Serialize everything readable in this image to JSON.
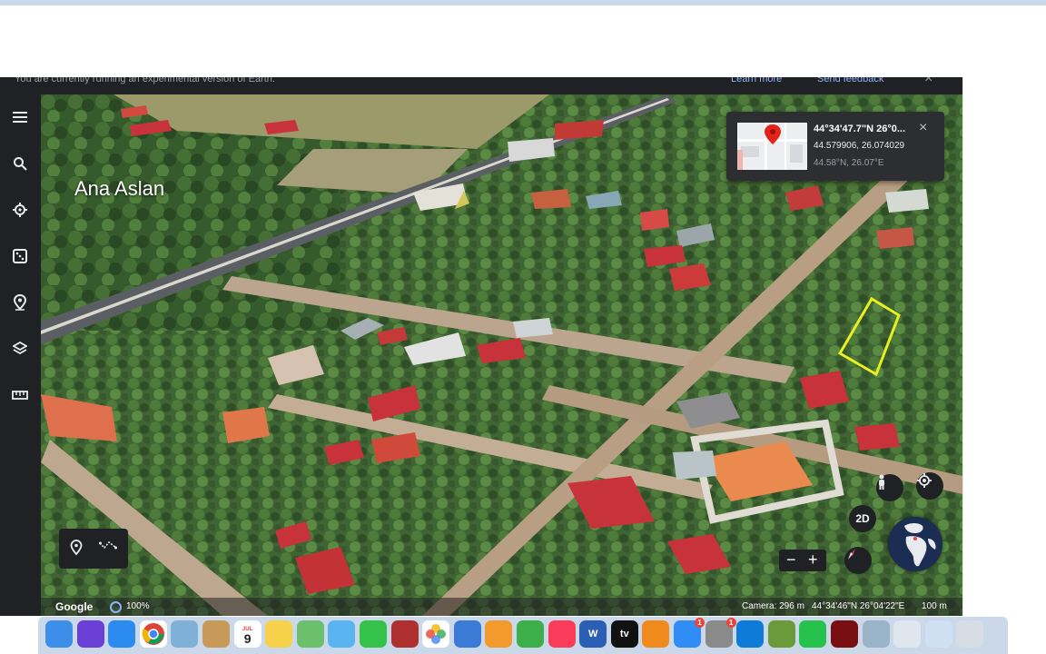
{
  "banner": {
    "message": "You are currently running an experimental version of Earth.",
    "learn_more": "Learn more",
    "send_feedback": "Send feedback",
    "close": "×"
  },
  "sidebar": {
    "items": [
      {
        "name": "menu-icon"
      },
      {
        "name": "search-icon"
      },
      {
        "name": "voyager-icon"
      },
      {
        "name": "feeling-lucky-icon"
      },
      {
        "name": "projects-icon"
      },
      {
        "name": "map-style-icon"
      },
      {
        "name": "measure-icon"
      }
    ]
  },
  "map": {
    "place_label": "Ana Aslan"
  },
  "info_card": {
    "title": "44°34'47.7\"N 26°0...",
    "decimal": "44.579906, 26.074029",
    "short": "44.58°N, 26.07°E",
    "close": "×"
  },
  "controls": {
    "view_2d": "2D",
    "zoom_out": "−",
    "zoom_in": "+"
  },
  "status": {
    "brand": "Google",
    "progress": "100%",
    "camera": "Camera: 296 m",
    "coordinates": "44°34'46\"N 26°04'22\"E",
    "scale": "100 m"
  },
  "dock": {
    "apps": [
      {
        "name": "finder",
        "color": "#3d8ee8"
      },
      {
        "name": "siri",
        "color": "#6a3fd8"
      },
      {
        "name": "safari",
        "color": "#2b8bef"
      },
      {
        "name": "chrome",
        "color": "#ffffff"
      },
      {
        "name": "preview",
        "color": "#7fb0d8"
      },
      {
        "name": "contacts",
        "color": "#c89a5a"
      },
      {
        "name": "calendar",
        "color": "#ffffff",
        "label": "9",
        "month": "JUL"
      },
      {
        "name": "notes",
        "color": "#f6d24a"
      },
      {
        "name": "maps",
        "color": "#6cc06c"
      },
      {
        "name": "messages-bubble",
        "color": "#5ab4f0"
      },
      {
        "name": "facetime",
        "color": "#35c24b"
      },
      {
        "name": "photo-booth",
        "color": "#b03030"
      },
      {
        "name": "photos",
        "color": "#ffffff"
      },
      {
        "name": "keynote",
        "color": "#3b7bd6"
      },
      {
        "name": "pages",
        "color": "#f29a2e"
      },
      {
        "name": "numbers",
        "color": "#3cae4a"
      },
      {
        "name": "music",
        "color": "#fa3b5a"
      },
      {
        "name": "word",
        "color": "#2b5fb4",
        "label": "W"
      },
      {
        "name": "apple-tv",
        "color": "#111111",
        "label": "tv"
      },
      {
        "name": "books",
        "color": "#f08a1c"
      },
      {
        "name": "app-store",
        "color": "#2f8df5",
        "badge": "1"
      },
      {
        "name": "system-preferences",
        "color": "#8a8a8a",
        "badge": "1"
      },
      {
        "name": "teamviewer",
        "color": "#0e7bd8"
      },
      {
        "name": "minecraft",
        "color": "#6b9a3a"
      },
      {
        "name": "whatsapp",
        "color": "#27c24c"
      },
      {
        "name": "flash-player",
        "color": "#7a0f12"
      },
      {
        "name": "screen-capture",
        "color": "#9ab3c8"
      },
      {
        "name": "downloads-stack",
        "color": "#dfe6ee"
      },
      {
        "name": "documents-stack",
        "color": "#cfe0f2"
      },
      {
        "name": "trash",
        "color": "#d6dde5"
      }
    ]
  }
}
